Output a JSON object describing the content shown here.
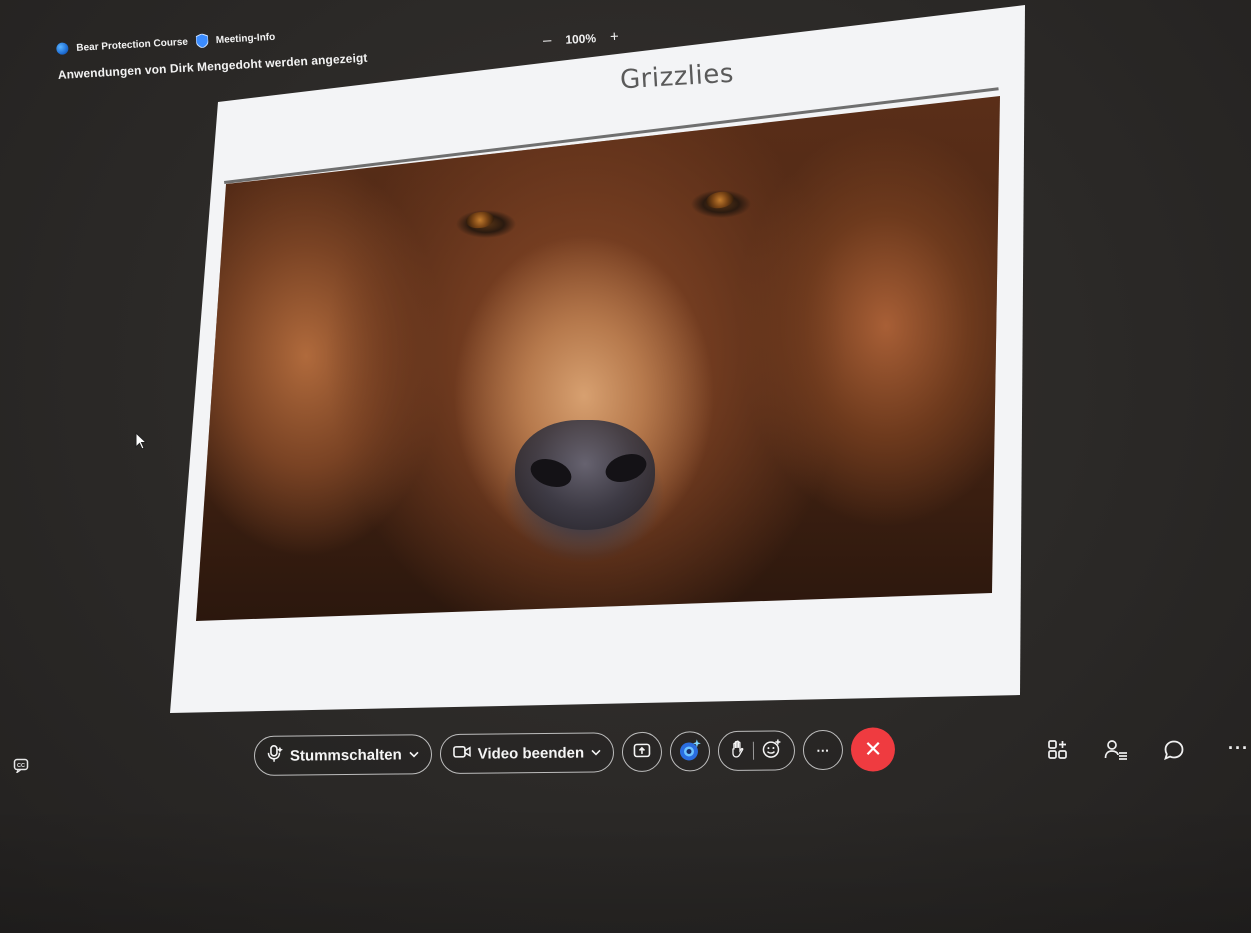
{
  "meeting": {
    "title": "Bear Protection Course",
    "info_label": "Meeting-Info",
    "sharing_notice": "Anwendungen von Dirk Mengedoht werden angezeigt"
  },
  "zoom": {
    "minus": "–",
    "value": "100%",
    "plus": "+"
  },
  "slide": {
    "title": "Grizzlies"
  },
  "toolbar": {
    "mute_label": "Stummschalten",
    "video_label": "Video beenden",
    "more_label": "···",
    "hangup_label": "✕"
  },
  "right_more_label": "···",
  "colors": {
    "hangup": "#ef3b40",
    "slide_bg": "#f3f4f6",
    "app_bg": "#2b2927",
    "accent_blue": "#1f6fd6"
  },
  "icons": {
    "cc": "closed-captions-icon",
    "mic": "microphone-icon",
    "camera": "camera-icon",
    "share": "share-screen-icon",
    "ai": "copilot-icon",
    "hand": "raise-hand-icon",
    "reaction": "reaction-smiley-icon",
    "layout": "layout-icon",
    "participants": "participants-icon",
    "chat": "chat-icon"
  }
}
